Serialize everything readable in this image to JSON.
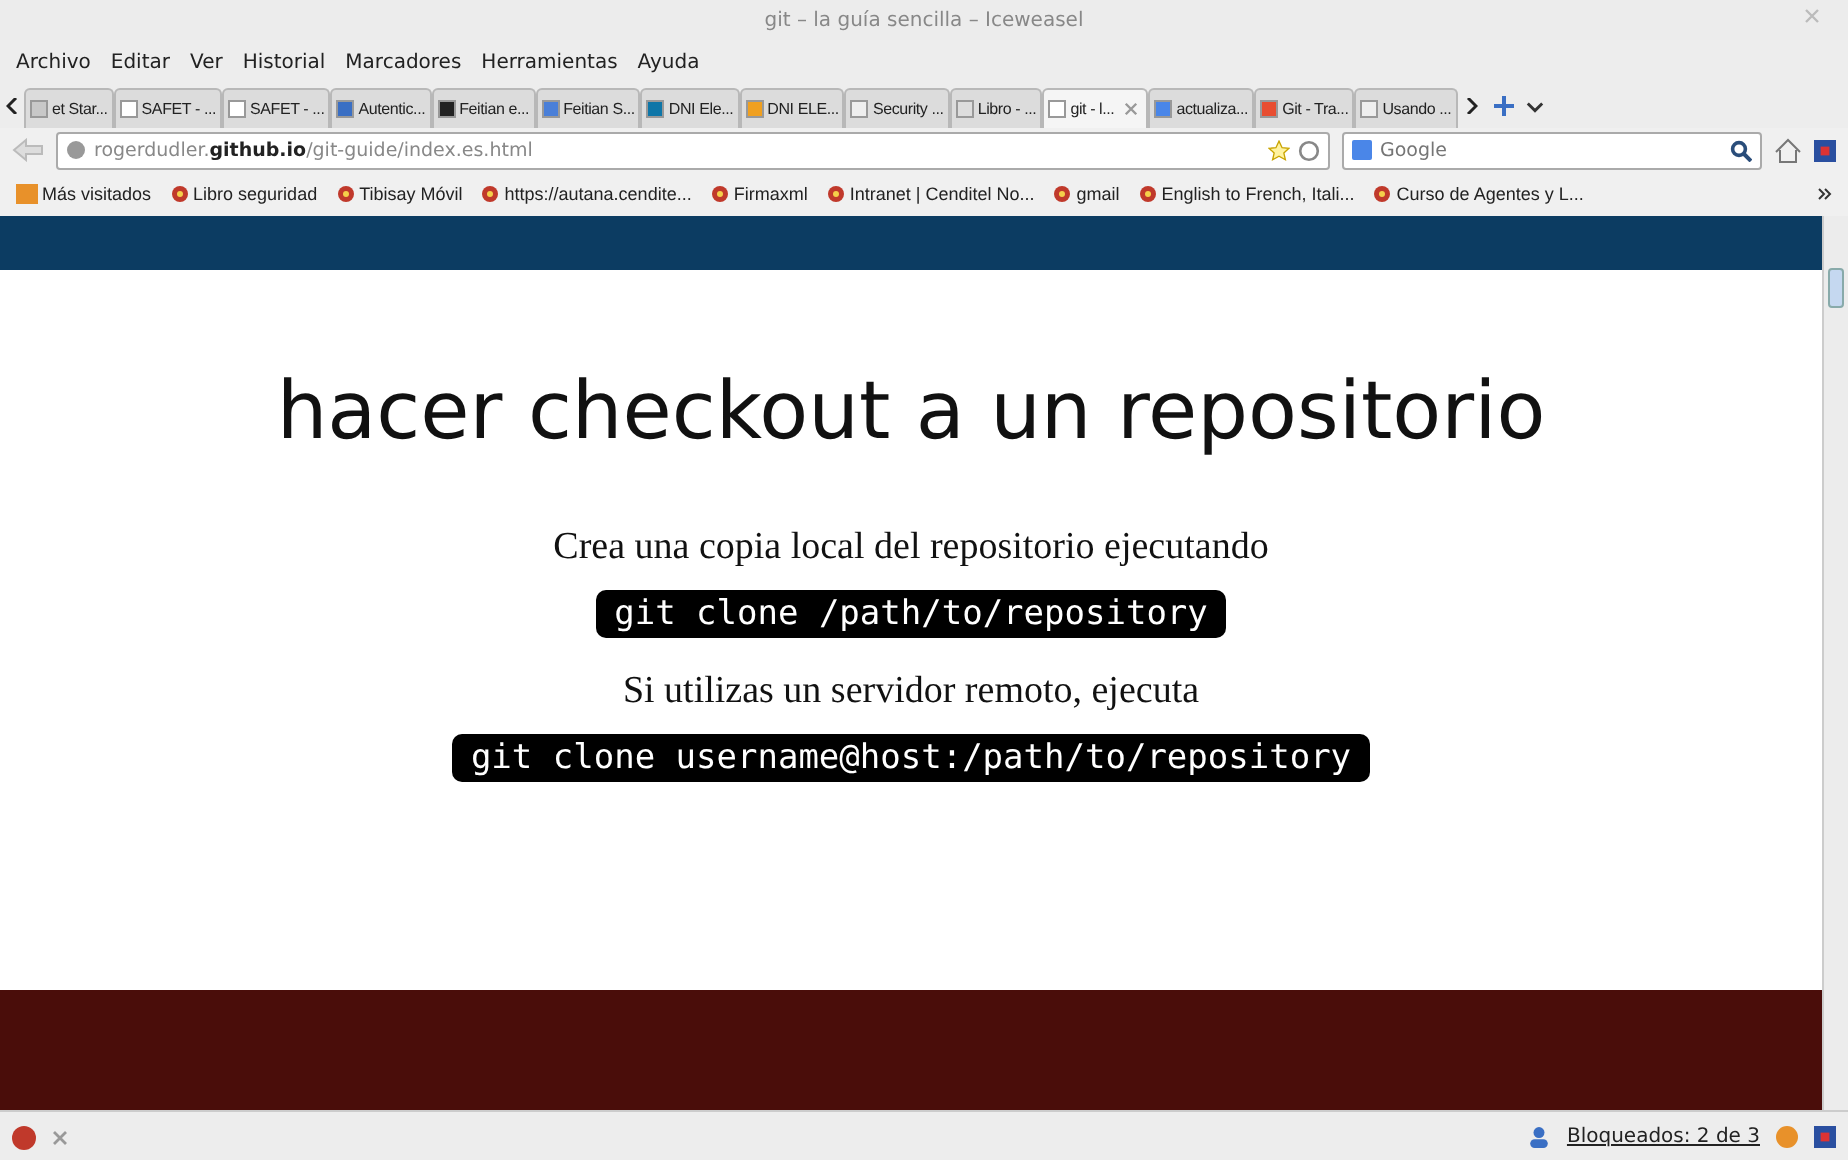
{
  "window": {
    "title": "git – la guía sencilla – Iceweasel"
  },
  "menu": [
    "Archivo",
    "Editar",
    "Ver",
    "Historial",
    "Marcadores",
    "Herramientas",
    "Ayuda"
  ],
  "tabs": [
    {
      "label": "et Star...",
      "selected": false,
      "color": "#c8c8c8"
    },
    {
      "label": "SAFET - ...",
      "selected": false,
      "color": "#ffffff"
    },
    {
      "label": "SAFET - ...",
      "selected": false,
      "color": "#ffffff"
    },
    {
      "label": "Autentic...",
      "selected": false,
      "color": "#3a6fc4"
    },
    {
      "label": "Feitian e...",
      "selected": false,
      "color": "#222222"
    },
    {
      "label": "Feitian S...",
      "selected": false,
      "color": "#4a7fd8"
    },
    {
      "label": "DNI Ele...",
      "selected": false,
      "color": "#0e76a8"
    },
    {
      "label": "DNI ELE...",
      "selected": false,
      "color": "#f0a020"
    },
    {
      "label": "Security ...",
      "selected": false,
      "color": "#eeeeee"
    },
    {
      "label": "Libro - ...",
      "selected": false,
      "color": "#dddddd"
    },
    {
      "label": "git - l...",
      "selected": true,
      "color": "#ffffff"
    },
    {
      "label": "actualiza...",
      "selected": false,
      "color": "#4a86e8"
    },
    {
      "label": "Git - Tra...",
      "selected": false,
      "color": "#e84e31"
    },
    {
      "label": "Usando ...",
      "selected": false,
      "color": "#eeeeee"
    }
  ],
  "address": {
    "host_prefix": "rogerdudler.",
    "domain": "github.io",
    "path": "/git-guide/index.es.html"
  },
  "search": {
    "placeholder": "Google"
  },
  "bookmarks": [
    "Más visitados",
    "Libro seguridad",
    "Tibisay Móvil",
    "https://autana.cendite...",
    "Firmaxml",
    "Intranet | Cenditel No...",
    "gmail",
    "English to French, Itali...",
    "Curso de Agentes y L..."
  ],
  "page": {
    "heading": "hacer checkout a un repositorio",
    "blocks": [
      {
        "kind": "text",
        "text": "Crea una copia local del repositorio ejecutando"
      },
      {
        "kind": "code",
        "text": "git clone /path/to/repository"
      },
      {
        "kind": "text",
        "text": "Si utilizas un servidor remoto, ejecuta"
      },
      {
        "kind": "code",
        "text": "git clone username@host:/path/to/repository"
      }
    ]
  },
  "status_bar": {
    "blocked": "Bloqueados: 2 de 3"
  }
}
